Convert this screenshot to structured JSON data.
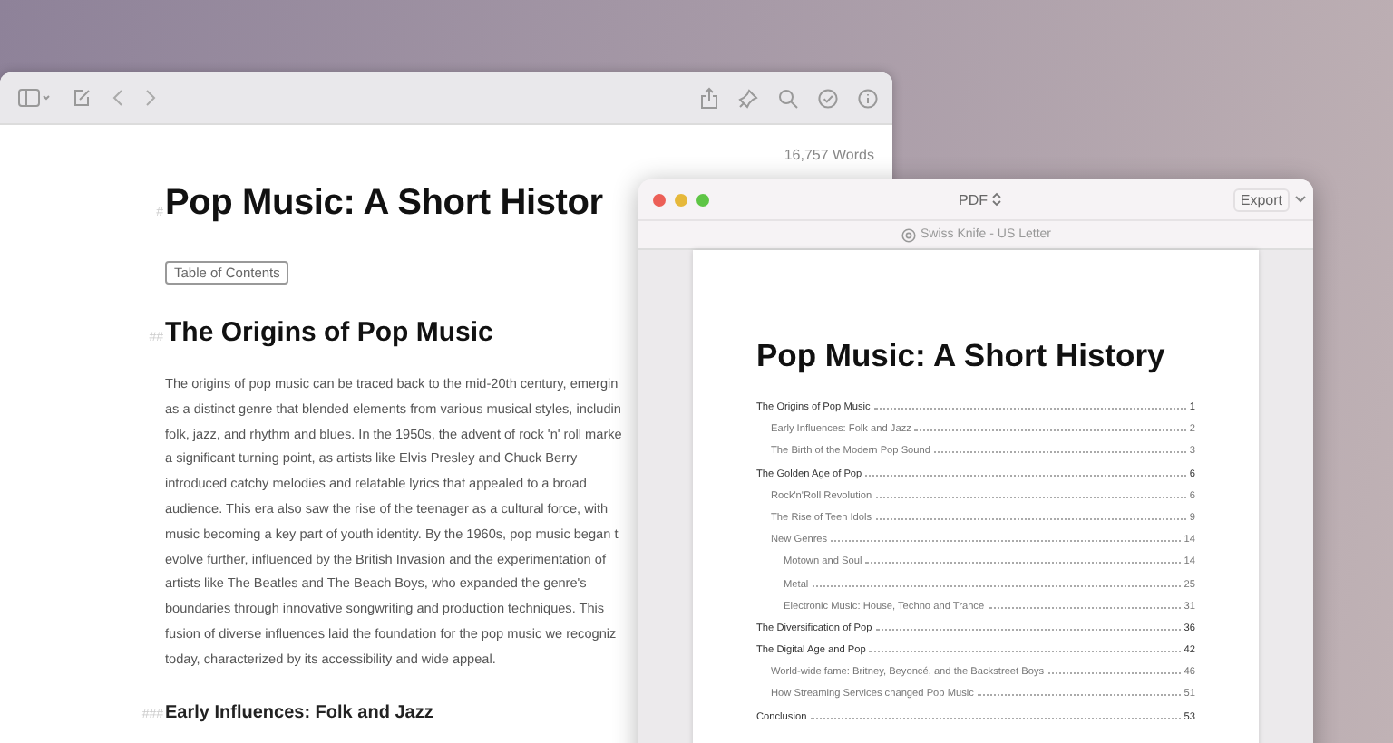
{
  "editor": {
    "word_count": "16,757 Words",
    "title_marker": "#",
    "title": "Pop Music: A Short Histor",
    "toc_button": "Table of Contents",
    "heading_marker": "##",
    "heading": "The Origins of Pop Music",
    "paragraph_lines": [
      "The origins of pop music can be traced back to the mid-20th century, emergin",
      "as a distinct genre that blended elements from various musical styles, includin",
      "folk, jazz, and rhythm and blues. In the 1950s, the advent of rock 'n' roll marke",
      "a significant turning point, as artists like Elvis Presley and Chuck Berry",
      "introduced catchy melodies and relatable lyrics that appealed to a broad",
      "audience. This era also saw the rise of the teenager as a cultural force, with",
      "music becoming a key part of youth identity. By the 1960s, pop music began t",
      "evolve further, influenced by the British Invasion and the experimentation of",
      "artists like The Beatles and The Beach Boys, who expanded the genre's",
      "boundaries through innovative songwriting and production techniques. This",
      "fusion of diverse influences laid the foundation for the pop music we recogniz",
      "today, characterized by its accessibility and wide appeal."
    ],
    "subheading_marker": "###",
    "subheading": "Early Influences: Folk and Jazz"
  },
  "pdf_window": {
    "format_menu": "PDF",
    "export_button": "Export",
    "template": "Swiss Knife - US Letter",
    "page": {
      "title": "Pop Music: A Short History",
      "toc": [
        {
          "label": "The Origins of Pop Music",
          "page": "1",
          "children": [
            {
              "label": "Early Influences: Folk and Jazz",
              "page": "2"
            },
            {
              "label": "The Birth of the Modern Pop Sound",
              "page": "3"
            }
          ]
        },
        {
          "label": "The Golden Age of Pop",
          "page": "6",
          "children": [
            {
              "label": "Rock'n'Roll Revolution",
              "page": "6"
            },
            {
              "label": "The Rise of Teen Idols",
              "page": "9"
            },
            {
              "label": "New Genres",
              "page": "14",
              "children": [
                {
                  "label": "Motown and Soul",
                  "page": "14"
                },
                {
                  "label": "Metal",
                  "page": "25"
                },
                {
                  "label": "Electronic Music: House, Techno and Trance",
                  "page": "31"
                }
              ]
            }
          ]
        },
        {
          "label": "The Diversification of Pop",
          "page": "36"
        },
        {
          "label": "The Digital Age and Pop",
          "page": "42",
          "children": [
            {
              "label": "World-wide fame: Britney, Beyoncé, and the Backstreet Boys",
              "page": "46"
            },
            {
              "label": "How Streaming Services changed Pop Music",
              "page": "51"
            }
          ]
        },
        {
          "label": "Conclusion",
          "page": "53"
        }
      ]
    }
  }
}
